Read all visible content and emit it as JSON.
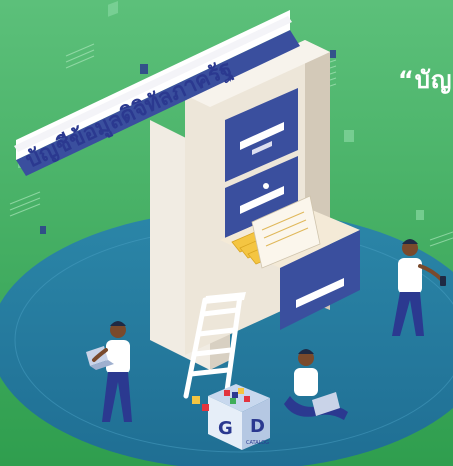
{
  "banner": {
    "title": "บัญชีข้อมูลดิจิทัลภาครัฐ"
  },
  "headline": {
    "text": "“บัญ"
  },
  "logo": {
    "letter_g": "G",
    "letter_d": "D",
    "caption": "CATALOG"
  },
  "colors": {
    "background": "#3fae5a",
    "platform": "#2a7fa0",
    "cabinet": "#efe8dc",
    "drawer": "#3a4f9e",
    "banner_text": "#2b3990",
    "folder": "#f4c542",
    "person_shirt": "#ffffff",
    "person_pants": "#2b3990"
  },
  "icons": [
    "ladder-icon",
    "filing-cabinet-icon",
    "data-catalog-logo-icon",
    "laptop-icon",
    "smartphone-icon"
  ]
}
